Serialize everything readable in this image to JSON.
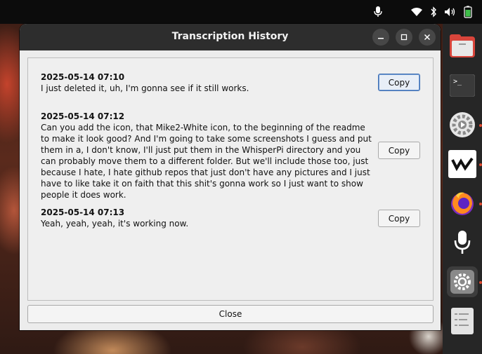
{
  "window": {
    "title": "Transcription History",
    "close_label": "Close"
  },
  "entries": [
    {
      "timestamp": "2025-05-14 07:10",
      "text": "I just deleted it, uh, I'm gonna see if it still works.",
      "copy_label": "Copy"
    },
    {
      "timestamp": "2025-05-14 07:12",
      "text": "Can you add the icon, that Mike2-White icon, to the beginning of the readme to make it look good? And I'm going to take some screenshots I guess and put them in a, I don't know, I'll just put them in the WhisperPi directory and you can probably move them to a different folder. But we'll include those too, just because I hate, I hate github repos that just don't have any pictures and I just have to like take it on faith that this shit's gonna work so I just want to show people it does work.",
      "copy_label": "Copy"
    },
    {
      "timestamp": "2025-05-14 07:13",
      "text": "Yeah, yeah, yeah, it's working now.",
      "copy_label": "Copy"
    }
  ],
  "tray_icons": [
    "microphone-icon",
    "wifi-icon",
    "bluetooth-icon",
    "volume-icon",
    "battery-icon"
  ],
  "dock_icons": [
    "files-icon",
    "terminal-icon",
    "settings-app-icon",
    "w-app-icon",
    "firefox-icon",
    "microphone-app-icon",
    "settings-icon",
    "text-editor-icon"
  ],
  "colors": {
    "titlebar": "#2d2d2d",
    "window_bg": "#ececec",
    "focus_accent": "#3f70b4",
    "dock_bg": "#262626",
    "running_dot": "#e04a2f"
  }
}
